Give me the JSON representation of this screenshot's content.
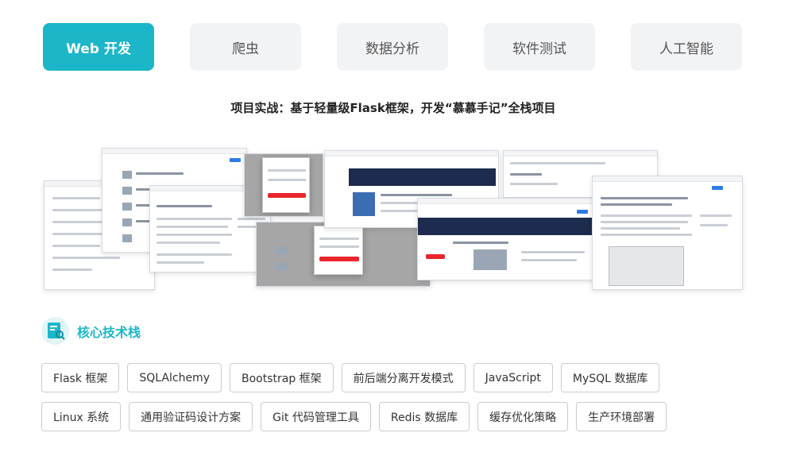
{
  "tabs": [
    {
      "label": "Web 开发",
      "active": true
    },
    {
      "label": "爬虫",
      "active": false
    },
    {
      "label": "数据分析",
      "active": false
    },
    {
      "label": "软件测试",
      "active": false
    },
    {
      "label": "人工智能",
      "active": false
    }
  ],
  "project": {
    "title": "项目实战：基于轻量级Flask框架，开发“慕慕手记”全栈项目"
  },
  "stack": {
    "title": "核心技术栈",
    "icon": "book-search-icon",
    "tags": [
      "Flask 框架",
      "SQLAlchemy",
      "Bootstrap 框架",
      "前后端分离开发模式",
      "JavaScript",
      "MySQL 数据库",
      "Linux 系统",
      "通用验证码设计方案",
      "Git 代码管理工具",
      "Redis 数据库",
      "缓存优化策略",
      "生产环境部署"
    ]
  },
  "colors": {
    "accent": "#1cb6c9",
    "tab_bg": "#f2f3f5",
    "red_button": "#e8262c",
    "banner": "#1d2b4e"
  }
}
